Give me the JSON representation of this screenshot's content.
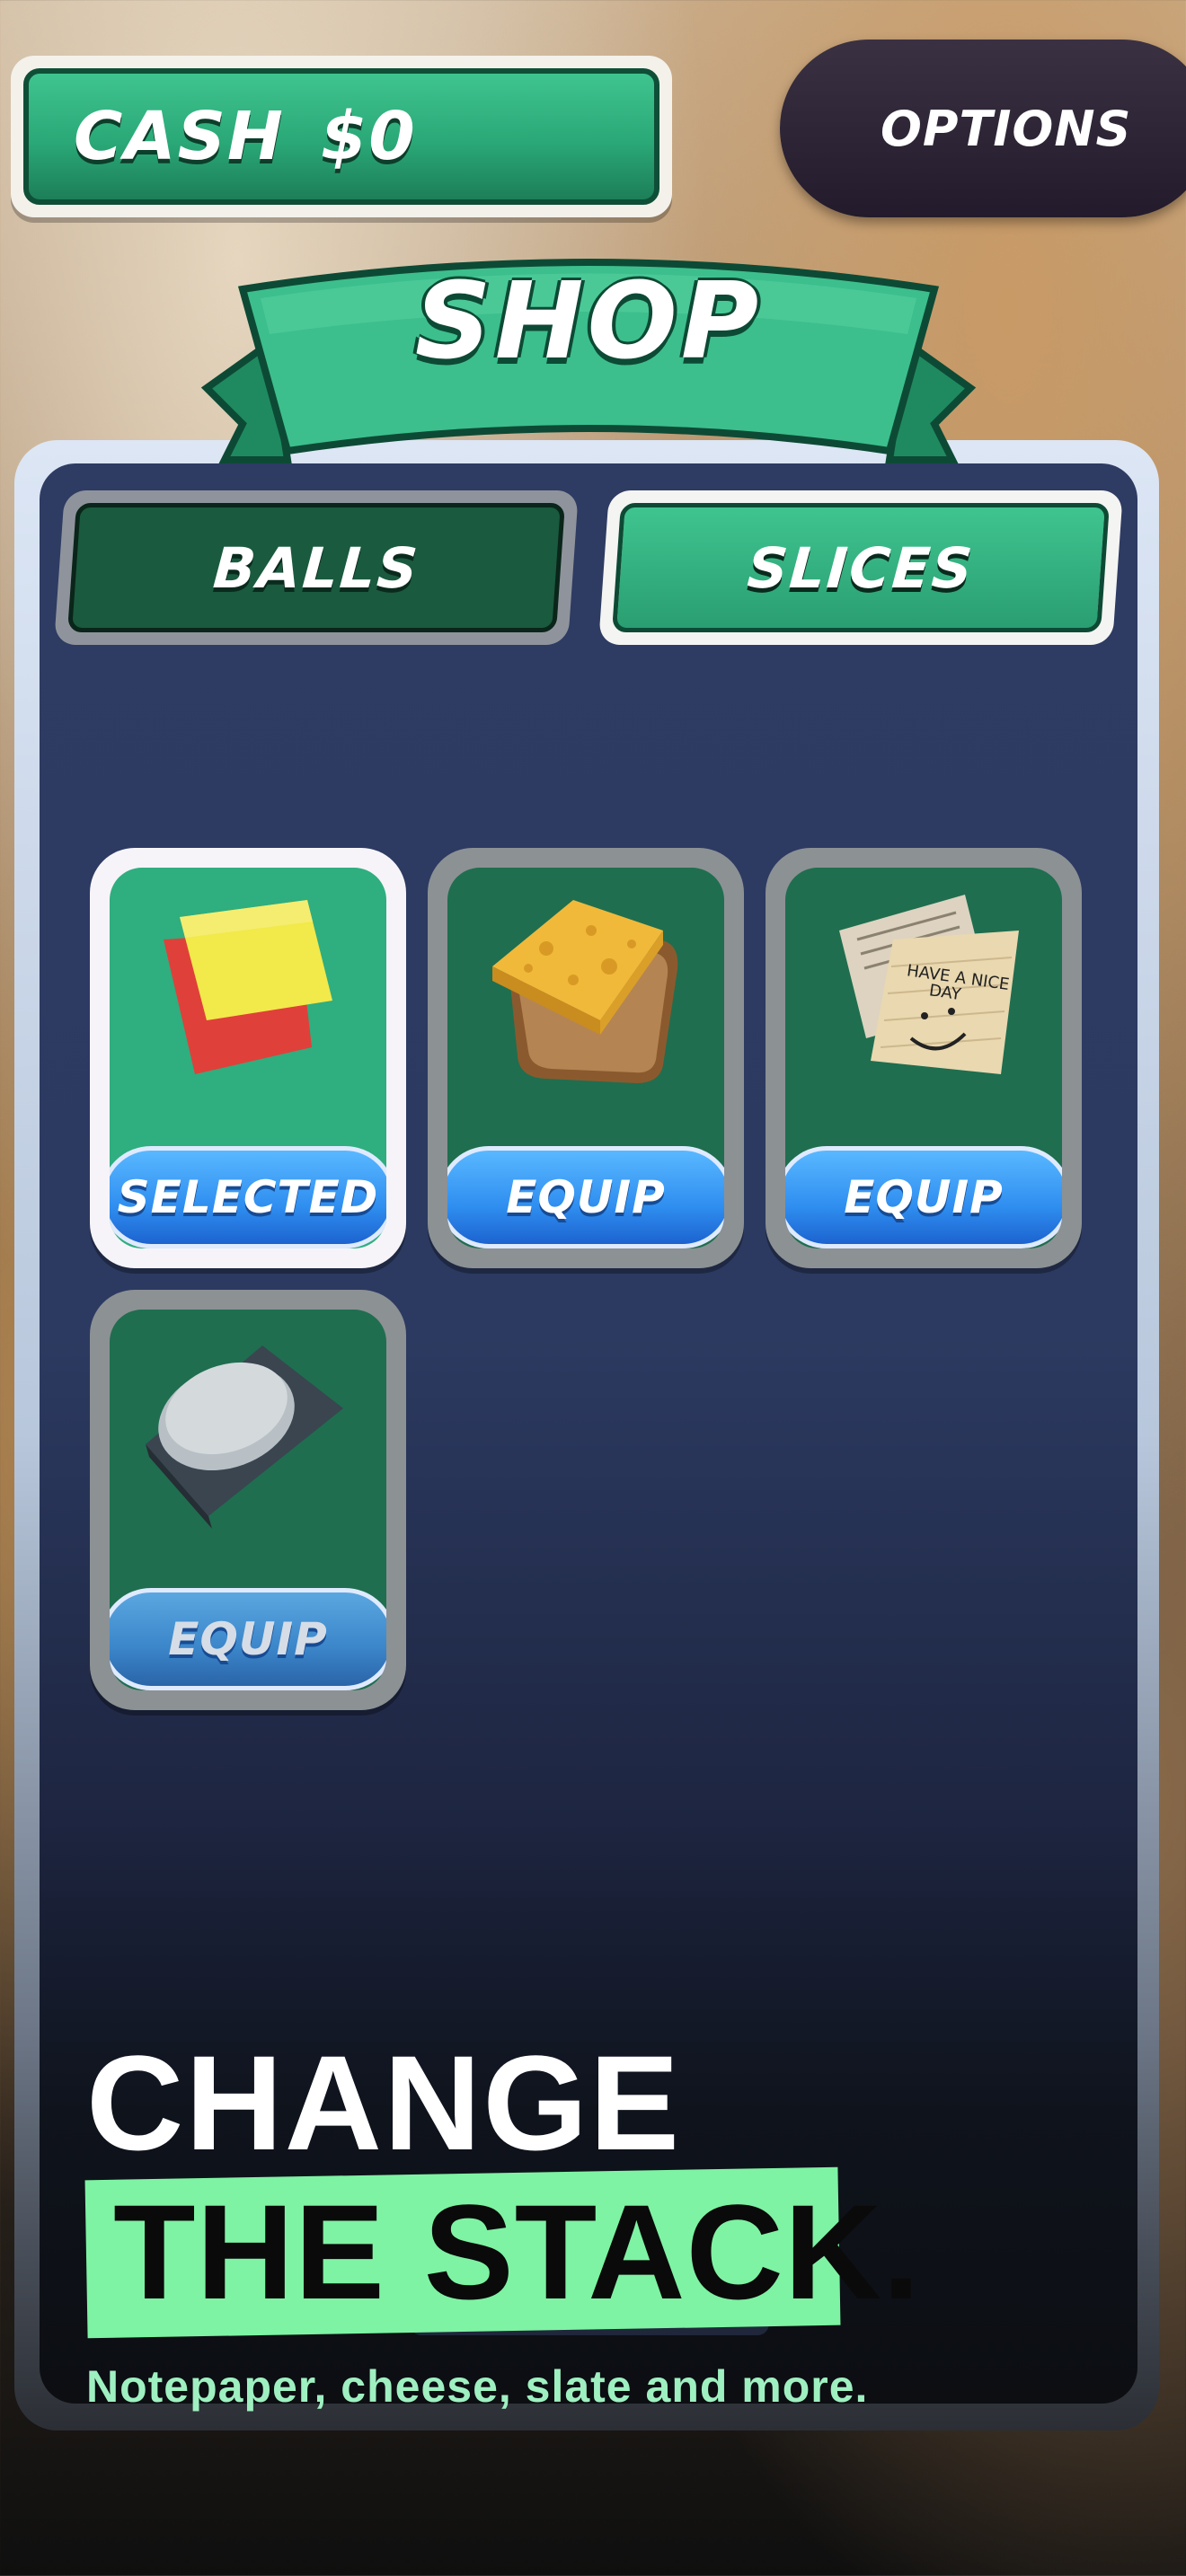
{
  "hud": {
    "cash_label": "CASH",
    "cash_value": "$0",
    "options_label": "OPTIONS"
  },
  "shop": {
    "title": "SHOP",
    "tabs": [
      {
        "label": "BALLS",
        "active": false
      },
      {
        "label": "SLICES",
        "active": true
      }
    ],
    "items": [
      {
        "icon": "paper-squares-icon",
        "button_label": "SELECTED",
        "selected": true
      },
      {
        "icon": "cheese-toast-icon",
        "button_label": "EQUIP",
        "selected": false
      },
      {
        "icon": "notepaper-icon",
        "button_label": "EQUIP",
        "selected": false
      },
      {
        "icon": "slate-disc-icon",
        "button_label": "EQUIP",
        "selected": false
      }
    ]
  },
  "promo": {
    "line1": "CHANGE",
    "line2": "THE STACK.",
    "subtitle": "Notepaper, cheese, slate and more."
  },
  "colors": {
    "accent_green": "#2aa877",
    "highlight_green": "#7ef3a3",
    "button_blue": "#2f8ef0",
    "panel_navy": "#2e3b63"
  }
}
